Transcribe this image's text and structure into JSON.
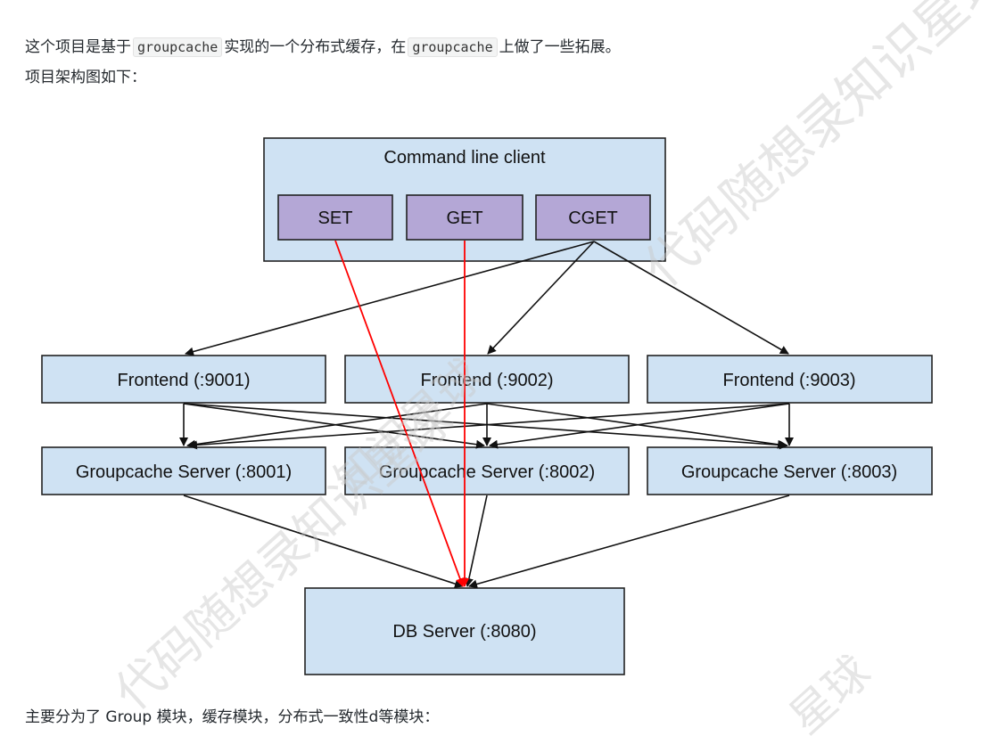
{
  "text": {
    "p1_a": "这个项目是基于",
    "p1_code1": "groupcache",
    "p1_b": "实现的一个分布式缓存，在",
    "p1_code2": "groupcache",
    "p1_c": "上做了一些拓展。",
    "p2": "项目架构图如下：",
    "p3": "主要分为了 Group 模块，缓存模块，分布式一致性d等模块："
  },
  "diagram": {
    "client_title": "Command line client",
    "commands": [
      "SET",
      "GET",
      "CGET"
    ],
    "frontends": [
      "Frontend (:9001)",
      "Frontend (:9002)",
      "Frontend (:9003)"
    ],
    "groupcache_servers": [
      "Groupcache Server (:8001)",
      "Groupcache Server (:8002)",
      "Groupcache Server (:8003)"
    ],
    "db_server": "DB Server (:8080)",
    "colors": {
      "box_fill": "#cfe2f3",
      "command_fill": "#b4a7d6",
      "direct_edge": "#ff0000",
      "edge": "#111111"
    }
  },
  "watermark": {
    "w1": "代码随想录知识星球",
    "w2": "代码随想录知识星球",
    "w3": "知识星球",
    "w4": "星球"
  }
}
